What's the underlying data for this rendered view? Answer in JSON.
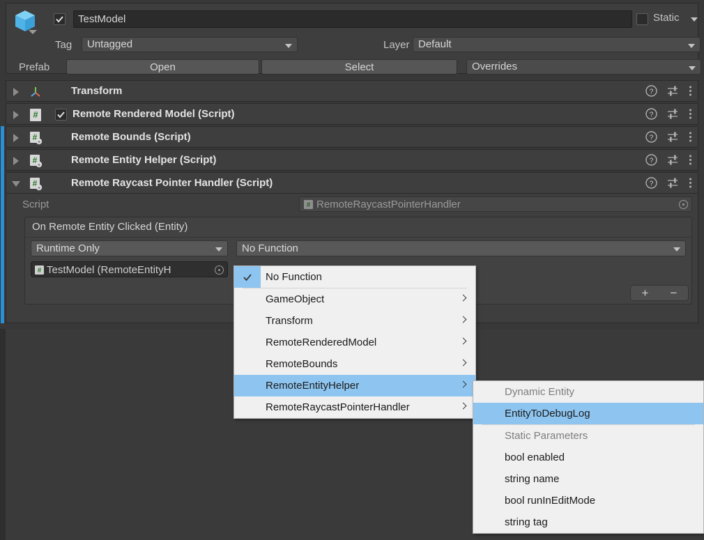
{
  "inspector": {
    "object_name": "TestModel",
    "object_enabled": true,
    "static_label": "Static",
    "static_checked": false,
    "tag_label": "Tag",
    "tag_value": "Untagged",
    "layer_label": "Layer",
    "layer_value": "Default",
    "prefab_label": "Prefab",
    "prefab_open": "Open",
    "prefab_select": "Select",
    "prefab_overrides": "Overrides"
  },
  "components": [
    {
      "title": "Transform",
      "expanded": false,
      "has_enable_checkbox": false,
      "enabled": false,
      "icon": "transform-icon",
      "selected_marker": false
    },
    {
      "title": "Remote Rendered Model (Script)",
      "expanded": false,
      "has_enable_checkbox": true,
      "enabled": true,
      "icon": "script-icon",
      "selected_marker": false
    },
    {
      "title": "Remote Bounds (Script)",
      "expanded": false,
      "has_enable_checkbox": false,
      "enabled": false,
      "icon": "script-add-icon",
      "selected_marker": true
    },
    {
      "title": "Remote Entity Helper (Script)",
      "expanded": false,
      "has_enable_checkbox": false,
      "enabled": false,
      "icon": "script-add-icon",
      "selected_marker": true
    },
    {
      "title": "Remote Raycast Pointer Handler (Script)",
      "expanded": true,
      "has_enable_checkbox": false,
      "enabled": false,
      "icon": "script-add-icon",
      "selected_marker": true
    }
  ],
  "row_icons": {
    "help": "help-icon",
    "preset": "preset-icon",
    "menu": "kebab-menu-icon"
  },
  "script_body": {
    "script_label": "Script",
    "script_value": "RemoteRaycastPointerHandler",
    "event_title": "On Remote Entity Clicked (Entity)",
    "call_mode": "Runtime Only",
    "call_function": "No Function",
    "call_object": "TestModel (RemoteEntityH",
    "add_label": "+",
    "remove_label": "−"
  },
  "function_menu": {
    "items": [
      {
        "label": "No Function",
        "checked": true,
        "submenu": false,
        "separator_after": true
      },
      {
        "label": "GameObject",
        "checked": false,
        "submenu": true
      },
      {
        "label": "Transform",
        "checked": false,
        "submenu": true
      },
      {
        "label": "RemoteRenderedModel",
        "checked": false,
        "submenu": true
      },
      {
        "label": "RemoteBounds",
        "checked": false,
        "submenu": true
      },
      {
        "label": "RemoteEntityHelper",
        "checked": false,
        "submenu": true,
        "highlighted": true
      },
      {
        "label": "RemoteRaycastPointerHandler",
        "checked": false,
        "submenu": true
      }
    ]
  },
  "function_submenu": {
    "items": [
      {
        "label": "Dynamic Entity",
        "header": true
      },
      {
        "label": "EntityToDebugLog",
        "highlighted": true,
        "separator_after": true
      },
      {
        "label": "Static Parameters",
        "header": true
      },
      {
        "label": "bool enabled"
      },
      {
        "label": "string name"
      },
      {
        "label": "bool runInEditMode"
      },
      {
        "label": "string tag"
      }
    ]
  },
  "colors": {
    "panel_bg": "#383838",
    "row_bg": "#3e3e3e",
    "accent_selection": "#2b8fd6",
    "menu_bg": "#F0F0F0",
    "menu_highlight": "#8EC5F0"
  }
}
